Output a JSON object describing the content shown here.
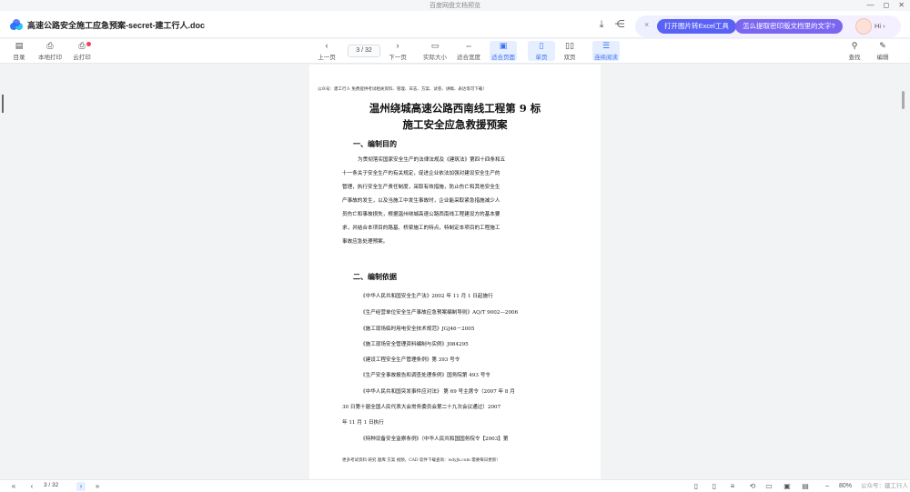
{
  "window": {
    "title": "百度网盘文档预览",
    "controls": [
      "—",
      "◻",
      "✕"
    ]
  },
  "header": {
    "doc_title": "高速公路安全施工应急预案-secret-建工行人.doc",
    "promo": {
      "close": "×",
      "btn1": "打开图片转Excel工具",
      "btn2": "怎么提取密印版文档里的文字?",
      "hi": "Hi ›"
    }
  },
  "toolbar": {
    "catalog": "目录",
    "local_print": "本地打印",
    "cloud_print": "云打印",
    "prev": "上一页",
    "page_indicator": "3 / 32",
    "next": "下一页",
    "actual_size": "实际大小",
    "fit_width": "适合宽度",
    "fit_page": "适合页面",
    "single": "单页",
    "double": "双页",
    "continuous": "连续阅读",
    "search": "查找",
    "edit": "编辑"
  },
  "doc": {
    "topnote": "公众号：建工行人 免费提供考试相关资料、管理、日志、方案、试卷、讲稿、表达等可下载!",
    "title1": "温州绕城高速公路西南线工程第 9 标",
    "title2": "施工安全应急救援预案",
    "sec1": "一、编制目的",
    "para1": [
      "为贯彻落实国家安全生产的法律法规及《建筑法》第四十四条和五",
      "十一条关于安全生产的有关规定，促进企业依法加强对建设安全生产的",
      "管理，执行安全生产责任制度，采取有效措施，防止伤亡和其他安全生",
      "产事故的发生，以及当施工中发生事故时，企业能采取紧急措施减少人",
      "员伤亡和事故损失，根据温州绕城高速公路西南线工程建设方的基本要",
      "求，并结合本项目的路基、桥梁施工的特点，特制定本项目的工程施工",
      "事故应急处理预案。"
    ],
    "sec2": "二、编制依据",
    "refs": [
      "《中华人民共和国安全生产法》2002 年 11 月 1 日起施行",
      "《生产经营单位安全生产事故应急预案编制导则》AQ/T 9002—2006",
      "《施工现场临时用电安全技术规范》JGJ46－2005",
      "《施工现场安全管理资料编制与实例》J084295",
      "《建设工程安全生产管理条例》第 393 号令",
      "《生产安全事故报告和调查处理条例》国务院第 493 号令",
      "《中华人民共和国突发事件应对法》 第 69 号主席令（2007 年 8 月",
      "30 日第十届全国人民代表大会常务委员会第二十九次会议通过）2007",
      "年 11 月 1 日执行",
      "《特种设备安全监察条例》（中华人民共和国国务院令【2003】第"
    ],
    "footnote": "更多考试资料 研究 题库 方案 视频，CAD 软件下载查询：wdyjk.com 需要每日更新!"
  },
  "status": {
    "page": "3 / 32",
    "zoom": "80%",
    "watermark": "公众号：建工行人"
  }
}
